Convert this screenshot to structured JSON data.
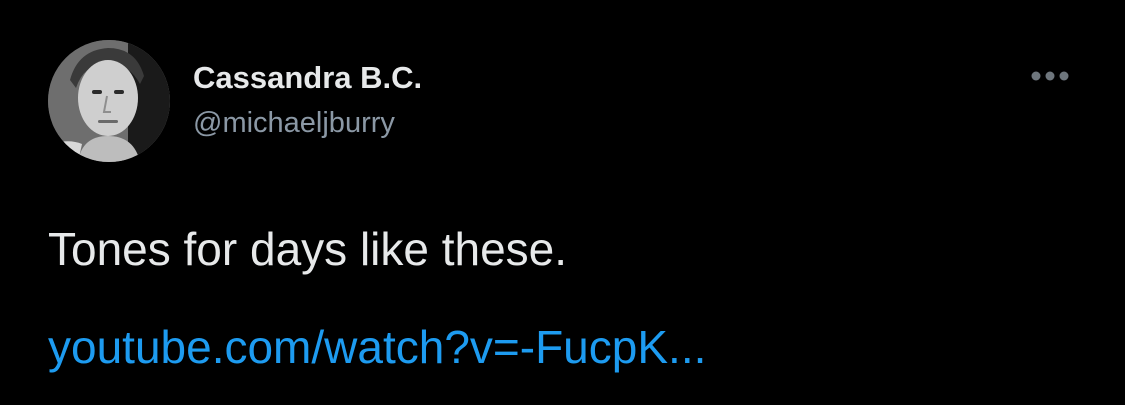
{
  "tweet": {
    "author": {
      "display_name": "Cassandra B.C.",
      "handle": "@michaeljburry",
      "avatar_icon": "profile-photo"
    },
    "text": "Tones for days like these.",
    "link": {
      "label": "youtube.com/watch?v=-FucpK..."
    },
    "more_icon": "ellipsis-icon"
  },
  "colors": {
    "background": "#000000",
    "primary_text": "#e7e9ea",
    "secondary_text": "#8b98a5",
    "link": "#1d9bf0"
  }
}
